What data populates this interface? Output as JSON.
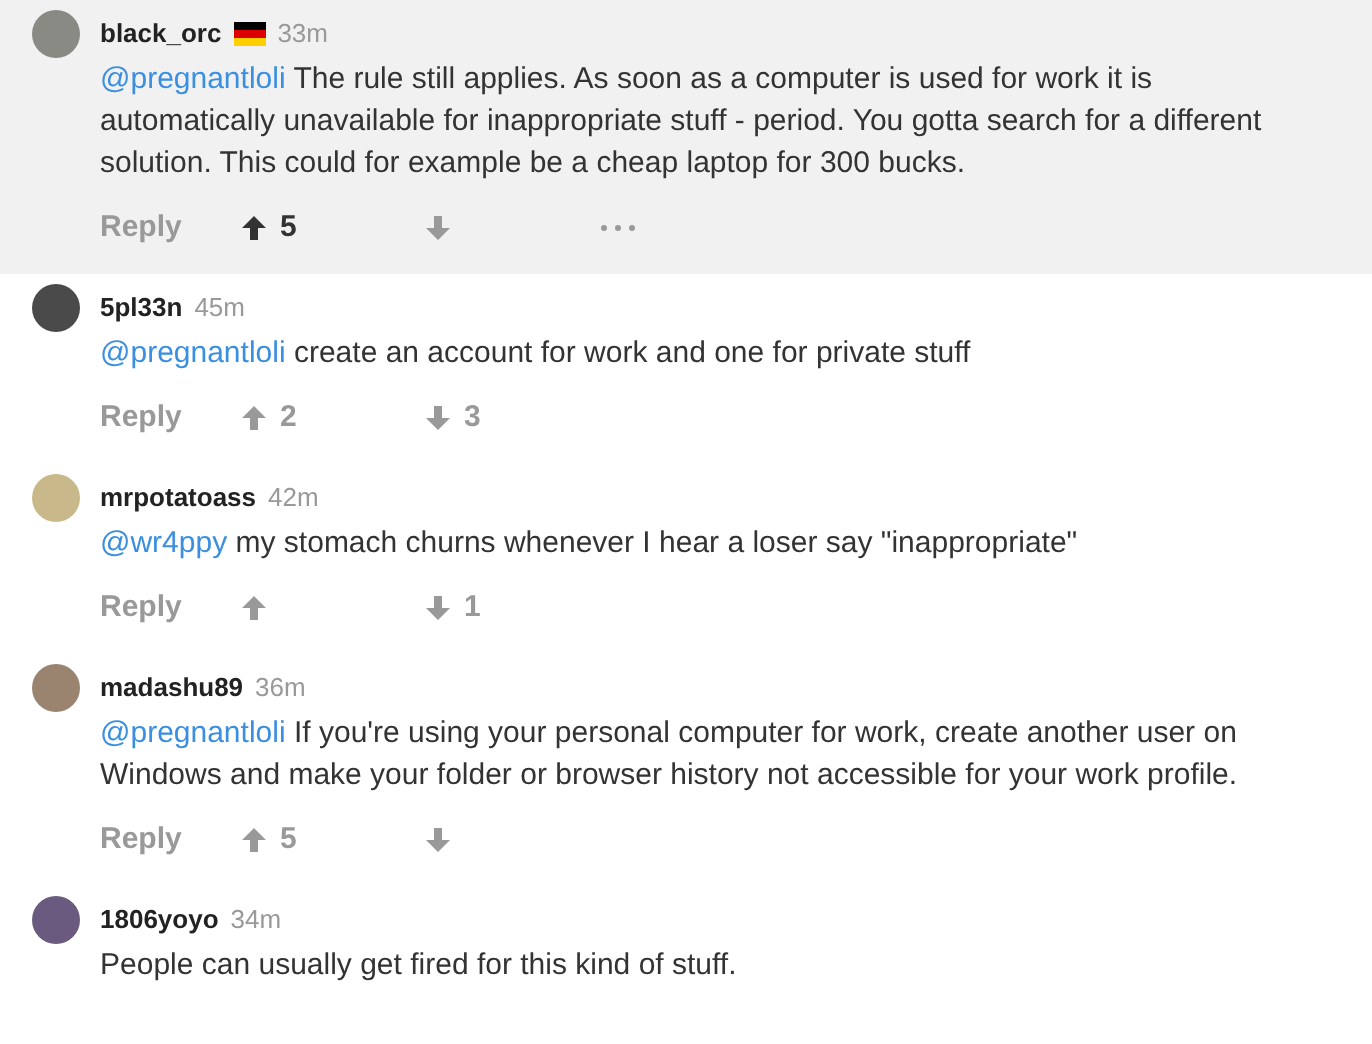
{
  "comments": [
    {
      "username": "black_orc",
      "has_flag": true,
      "time": "33m",
      "highlighted": true,
      "mention": "@pregnantloli",
      "text": "The rule still applies. As soon as a computer is used for work it is automatically unavailable for inappropriate stuff - period. You gotta search for a different solution. This could for example be a cheap laptop for 300 bucks.",
      "reply": "Reply",
      "upvotes": "5",
      "upvoted": true,
      "more_menu": true
    },
    {
      "username": "5pl33n",
      "time": "45m",
      "highlighted": false,
      "mention": "@pregnantloli",
      "text": "create an account for work and one for private stuff",
      "reply": "Reply",
      "upvotes": "2",
      "upvoted": false,
      "downvotes": "3"
    },
    {
      "username": "mrpotatoass",
      "time": "42m",
      "highlighted": false,
      "mention": "@wr4ppy",
      "text": "my stomach churns whenever I hear a loser say \"inappropriate\"",
      "reply": "Reply",
      "upvoted": false,
      "downvotes": "1"
    },
    {
      "username": "madashu89",
      "time": "36m",
      "highlighted": false,
      "mention": "@pregnantloli",
      "text": "If you're using your personal computer for work, create another user on Windows and make your folder or browser history not accessible for your work profile.",
      "reply": "Reply",
      "upvotes": "5",
      "upvoted": false
    },
    {
      "username": "1806yoyo",
      "time": "34m",
      "highlighted": false,
      "text": "People can usually get fired for this kind of stuff."
    }
  ]
}
